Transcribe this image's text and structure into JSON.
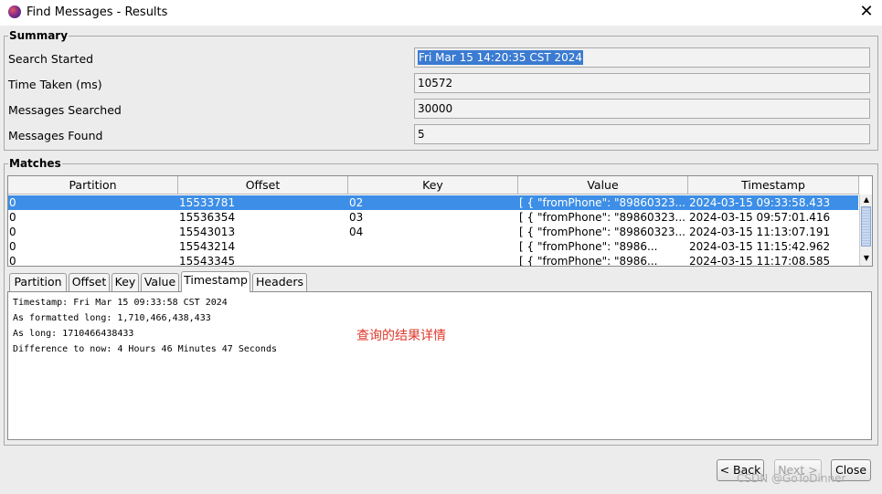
{
  "window": {
    "title": "Find Messages - Results",
    "close_glyph": "✕"
  },
  "summary": {
    "legend": "Summary",
    "rows": [
      {
        "label": "Search Started",
        "value": "Fri Mar 15 14:20:35 CST 2024"
      },
      {
        "label": "Time Taken (ms)",
        "value": "10572"
      },
      {
        "label": "Messages Searched",
        "value": "30000"
      },
      {
        "label": "Messages Found",
        "value": "5"
      }
    ]
  },
  "matches": {
    "legend": "Matches",
    "columns": [
      "Partition",
      "Offset",
      "Key",
      "Value",
      "Timestamp"
    ],
    "rows": [
      {
        "partition": "0",
        "offset": "15533781",
        "key": "02",
        "value": "[  {    \"fromPhone\": \"89860323...",
        "timestamp": "2024-03-15 09:33:58.433"
      },
      {
        "partition": "0",
        "offset": "15536354",
        "key": "03",
        "value": "[  {    \"fromPhone\": \"89860323...",
        "timestamp": "2024-03-15 09:57:01.416"
      },
      {
        "partition": "0",
        "offset": "15543013",
        "key": "04",
        "value": "[  {    \"fromPhone\": \"89860323...",
        "timestamp": "2024-03-15 11:13:07.191"
      },
      {
        "partition": "0",
        "offset": "15543214",
        "key": "",
        "value": "[    {          \"fromPhone\": \"8986...",
        "timestamp": "2024-03-15 11:15:42.962"
      },
      {
        "partition": "0",
        "offset": "15543345",
        "key": "",
        "value": "[    {          \"fromPhone\": \"8986...",
        "timestamp": "2024-03-15 11:17:08.585"
      }
    ],
    "selected_index": 0
  },
  "tabs": [
    "Partition",
    "Offset",
    "Key",
    "Value",
    "Timestamp",
    "Headers"
  ],
  "active_tab": "Timestamp",
  "detail": {
    "lines": [
      "Timestamp: Fri Mar 15 09:33:58 CST 2024",
      "As formatted long: 1,710,466,438,433",
      "As long: 1710466438433",
      "Difference to now: 4 Hours 46 Minutes 47 Seconds"
    ]
  },
  "annotation": "查询的结果详情",
  "buttons": {
    "back": "< Back",
    "next": "Next >",
    "close": "Close"
  },
  "watermark": "CSDN @GoToDinner",
  "colors": {
    "selection": "#3d8ee6",
    "annotation": "#e0382b"
  }
}
